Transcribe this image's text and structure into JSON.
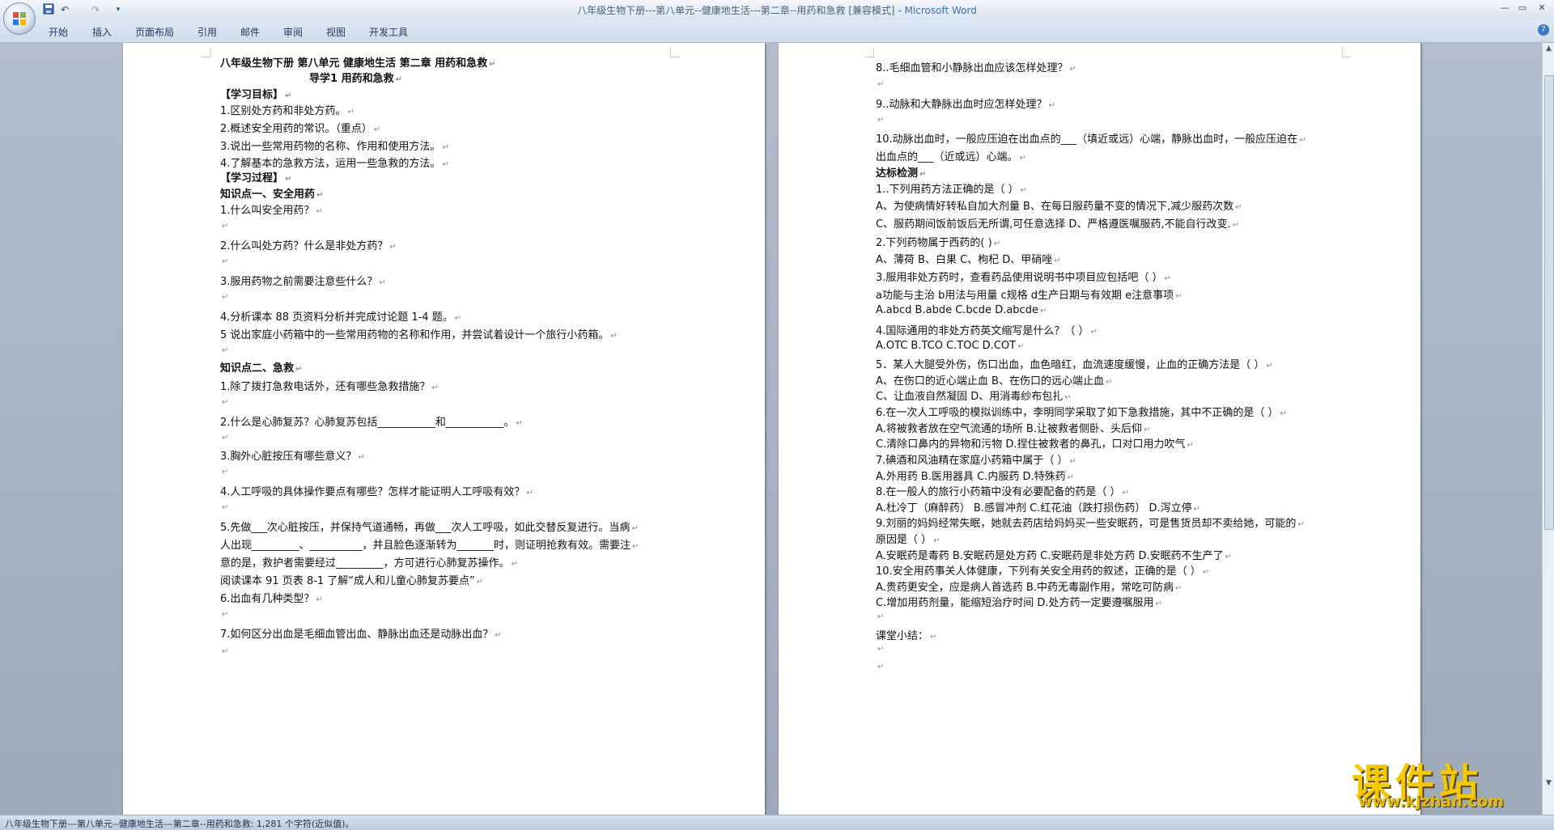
{
  "window": {
    "title": "八年级生物下册---第八单元--健康地生活---第二章--用药和急救 [兼容模式]",
    "app_name": "Microsoft Word"
  },
  "ribbon_tabs": [
    "开始",
    "插入",
    "页面布局",
    "引用",
    "邮件",
    "审阅",
    "视图",
    "开发工具"
  ],
  "page1_lines": [
    "八年级生物下册    第八单元    健康地生活      第二章    用药和急救",
    "导学1     用药和急救",
    "【学习目标】",
    "1.区别处方药和非处方药。",
    "2.概述安全用药的常识。（重点）",
    "3.说出一些常用药物的名称、作用和使用方法。",
    "4.了解基本的急救方法，运用一些急救的方法。",
    "【学习过程】",
    "知识点一、安全用药",
    "1.什么叫安全用药？",
    "",
    "2.什么叫处方药？什么是非处方药？",
    "",
    "3.服用药物之前需要注意些什么？",
    "",
    "4.分析课本 88 页资料分析并完成讨论题 1-4 题。",
    "5 说出家庭小药箱中的一些常用药物的名称和作用，并尝试着设计一个旅行小药箱。",
    "",
    "知识点二、急救",
    "1.除了拨打急救电话外，还有哪些急救措施？",
    "",
    "2.什么是心肺复苏？心肺复苏包括___________和___________。",
    "",
    "3.胸外心脏按压有哪些意义？",
    "",
    "4.人工呼吸的具体操作要点有哪些？怎样才能证明人工呼吸有效？",
    "",
    "5.先做___次心脏按压，并保持气道通畅，再做___次人工呼吸，如此交替反复进行。当病",
    "人出现_________、__________，并且脸色逐渐转为_______时，则证明抢救有效。需要注",
    "意的是，救护者需要经过_________，方可进行心肺复苏操作。",
    "    阅读课本 91 页表 8-1 了解“成人和儿童心肺复苏要点”",
    "6.出血有几种类型？",
    "",
    "7.如何区分出血是毛细血管出血、静脉出血还是动脉出血？",
    ""
  ],
  "page2_lines": [
    "8..毛细血管和小静脉出血应该怎样处理？",
    "",
    "9..动脉和大静脉出血时应怎样处理？",
    "",
    "10.动脉出血时，一般应压迫在出血点的___（填近或远）心端，静脉出血时，一般应压迫在",
    "出血点的___（近或远）心端。",
    "达标检测",
    "1..下列用药方法正确的是（  ）",
    "A、为使病情好转私自加大剂量              B、在每日服药量不变的情况下,减少服药次数",
    "C、服药期间饭前饭后无所谓,可任意选择     D、严格遵医嘱服药,不能自行改变.",
    "2.下列药物属于西药的(    )",
    "A、薄荷     B、白果      C、枸杞      D、甲硝唑",
    "3.服用非处方药时，查看药品使用说明书中项目应包括吧（  ）",
    "   a功能与主治 b用法与用量 c规格 d生产日期与有效期 e注意事项",
    "A.abcd  B.abde  C.bcde  D.abcde",
    "4.国际通用的非处方药英文缩写是什么？（      ）",
    "A.OTC       B.TCO         C.TOC        D.COT",
    "5．某人大腿受外伤，伤口出血，血色暗红，血流速度缓慢，止血的正确方法是（  ）",
    "A、在伤口的近心端止血                    B、在伤口的远心端止血",
    "C、让血液自然凝固                        D、用消毒纱布包扎",
    "6.在一次人工呼吸的模拟训练中，李明同学采取了如下急救措施，其中不正确的是（  ）",
    "A.将被救者放在空气流通的场所  B.让被救者侧卧、头后仰",
    "C.清除口鼻内的异物和污物       D.捏住被救者的鼻孔，口对口用力吹气",
    "7.碘酒和风油精在家庭小药箱中属于（  ）",
    "A.外用药  B.医用器具  C.内服药  D.特殊药",
    "8.在一般人的旅行小药箱中没有必要配备的药是（ ）",
    "A.杜冷丁（麻醉药） B.感冒冲剂  C.红花油（跌打损伤药）  D.泻立停",
    "9.刘丽的妈妈经常失眠，她就去药店给妈妈买一些安眠药，可是售货员却不卖给她，可能的",
    "原因是（ ）",
    "A.安眠药是毒药  B.安眠药是处方药  C.安眠药是非处方药  D.安眠药不生产了",
    "10.安全用药事关人体健康，下列有关安全用药的叙述，正确的是（  ）",
    "A.贵药更安全，应是病人首选药  B.中药无毒副作用，常吃可防病",
    "C.增加用药剂量，能缩短治疗时间  D.处方药一定要遵嘱服用",
    "",
    "课堂小结：",
    "",
    ""
  ],
  "status": {
    "text": "八年级生物下册---第八单元--健康地生活---第二章--用药和急救: 1,281 个字符(近似值)。"
  },
  "watermark": {
    "text": "课件站",
    "url": "www.kjzhan.com"
  },
  "colors": {
    "page_bg": "#ffffff",
    "workspace_bg": "#9ba6b7",
    "title_app_accent": "#3a6fc0",
    "watermark_yellow": "#f6c800"
  },
  "icons": [
    "office-button-icon",
    "save-icon",
    "undo-icon",
    "redo-icon",
    "customize-qat-icon",
    "minimize-icon",
    "maximize-icon",
    "close-icon",
    "help-icon"
  ]
}
